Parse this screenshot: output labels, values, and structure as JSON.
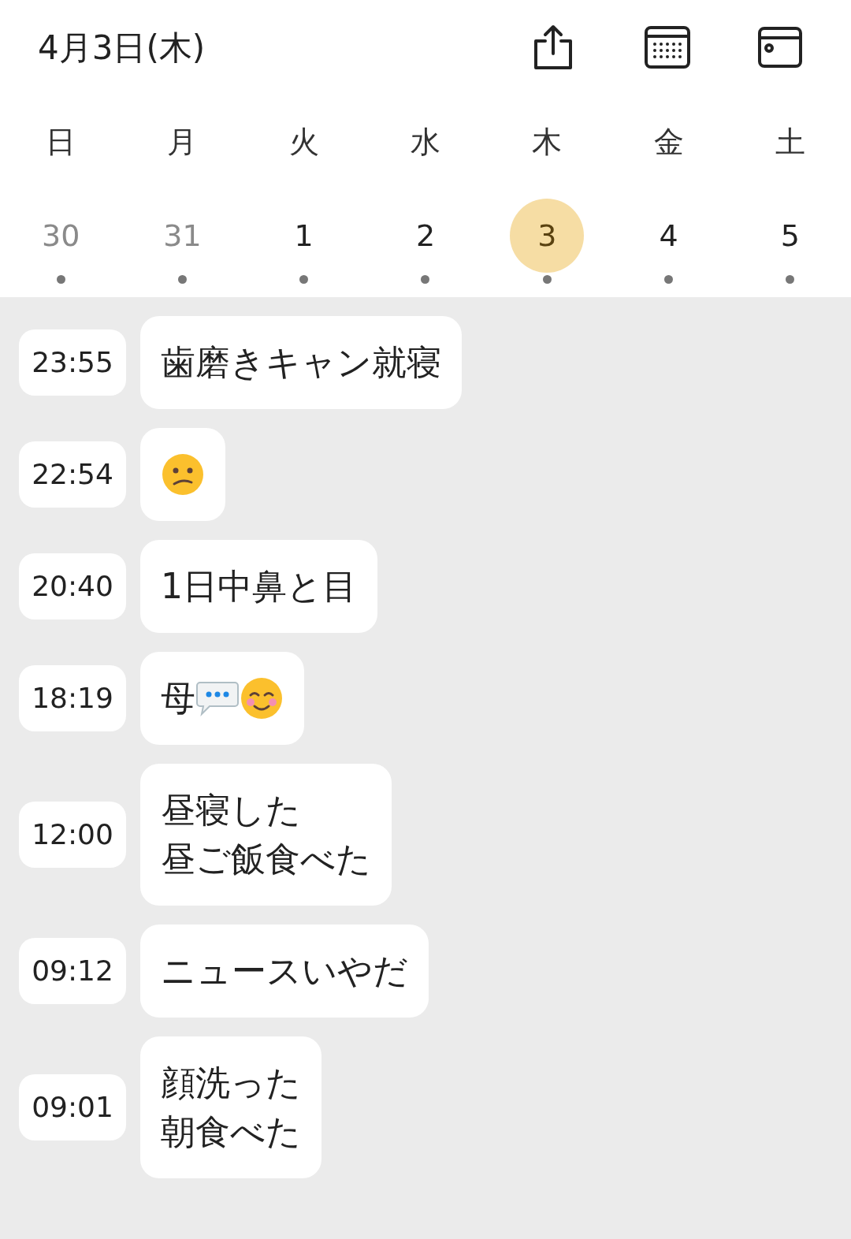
{
  "header": {
    "title": "4月3日(木)"
  },
  "weekdays": [
    "日",
    "月",
    "火",
    "水",
    "木",
    "金",
    "土"
  ],
  "days": [
    {
      "label": "30",
      "selected": false,
      "other_month": true
    },
    {
      "label": "31",
      "selected": false,
      "other_month": true
    },
    {
      "label": "1",
      "selected": false,
      "other_month": false
    },
    {
      "label": "2",
      "selected": false,
      "other_month": false
    },
    {
      "label": "3",
      "selected": true,
      "other_month": false
    },
    {
      "label": "4",
      "selected": false,
      "other_month": false
    },
    {
      "label": "5",
      "selected": false,
      "other_month": false
    }
  ],
  "entries": [
    {
      "time": "23:55",
      "parts": [
        {
          "kind": "text",
          "text": "歯磨きキャン就寝"
        }
      ]
    },
    {
      "time": "22:54",
      "parts": [
        {
          "kind": "frown"
        }
      ]
    },
    {
      "time": "20:40",
      "parts": [
        {
          "kind": "text",
          "text": "1日中鼻と目"
        }
      ]
    },
    {
      "time": "18:19",
      "parts": [
        {
          "kind": "text",
          "text": "母"
        },
        {
          "kind": "chat"
        },
        {
          "kind": "smile"
        }
      ]
    },
    {
      "time": "12:00",
      "parts": [
        {
          "kind": "text",
          "text": "昼寝した"
        },
        {
          "kind": "break"
        },
        {
          "kind": "text",
          "text": "昼ご飯食べた"
        }
      ]
    },
    {
      "time": "09:12",
      "parts": [
        {
          "kind": "text",
          "text": "ニュースいやだ"
        }
      ]
    },
    {
      "time": "09:01",
      "parts": [
        {
          "kind": "text",
          "text": "顔洗った"
        },
        {
          "kind": "break"
        },
        {
          "kind": "text",
          "text": "朝食べた"
        }
      ]
    }
  ]
}
